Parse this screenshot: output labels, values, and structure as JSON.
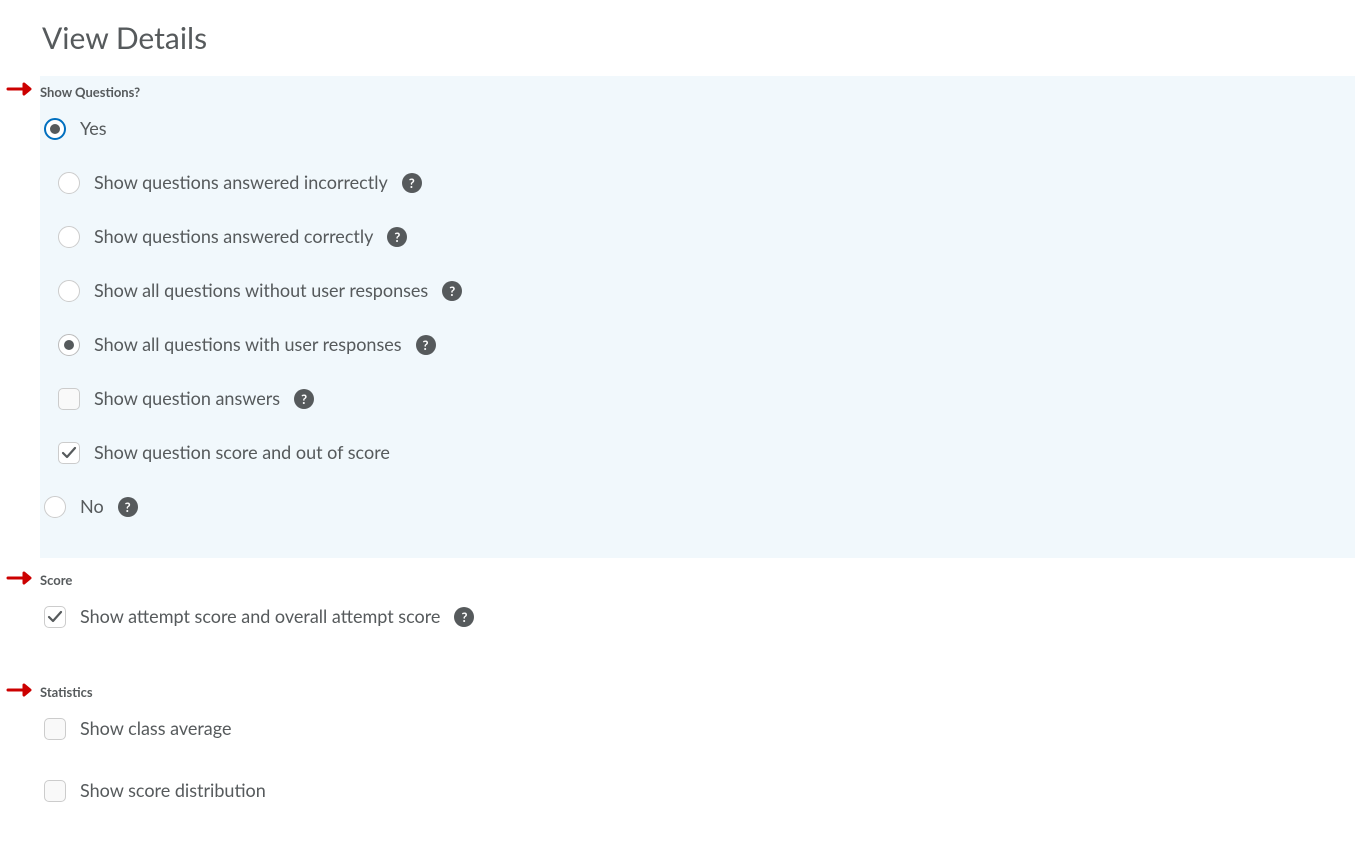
{
  "heading": "View Details",
  "sections": {
    "showQuestions": {
      "label": "Show Questions?",
      "yes": "Yes",
      "options": {
        "incorrectly": "Show questions answered incorrectly",
        "correctly": "Show questions answered correctly",
        "withoutResponses": "Show all questions without user responses",
        "withResponses": "Show all questions with user responses",
        "answers": "Show question answers",
        "scoreOutOf": "Show question score and out of score"
      },
      "no": "No"
    },
    "score": {
      "label": "Score",
      "attemptScore": "Show attempt score and overall attempt score"
    },
    "statistics": {
      "label": "Statistics",
      "classAverage": "Show class average",
      "scoreDistribution": "Show score distribution"
    }
  },
  "helpGlyph": "?"
}
